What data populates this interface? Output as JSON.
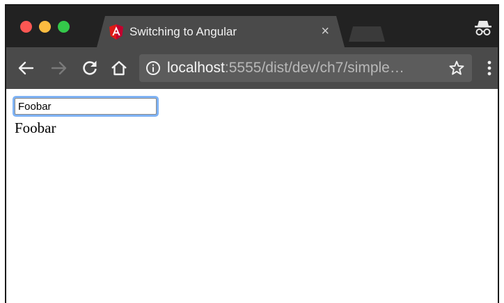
{
  "browser": {
    "tab": {
      "title": "Switching to Angular",
      "close_glyph": "×",
      "favicon": "angular-icon"
    },
    "toolbar": {
      "back_icon": "arrow-left-icon",
      "forward_icon": "arrow-right-icon",
      "reload_icon": "reload-icon",
      "home_icon": "home-icon",
      "info_icon": "info-circle-icon",
      "star_icon": "star-icon",
      "menu_icon": "kebab-menu-icon",
      "incognito_icon": "incognito-icon"
    },
    "address_bar": {
      "host": "localhost",
      "rest": ":5555/dist/dev/ch7/simple…"
    },
    "colors": {
      "tabstrip": "#222222",
      "toolbar": "#4a4a4a",
      "omnibox": "#5c5c5c",
      "angular_red": "#dd1b16",
      "focus_ring": "#7fb3f5"
    }
  },
  "page": {
    "input_value": "Foobar",
    "output_text": "Foobar"
  }
}
